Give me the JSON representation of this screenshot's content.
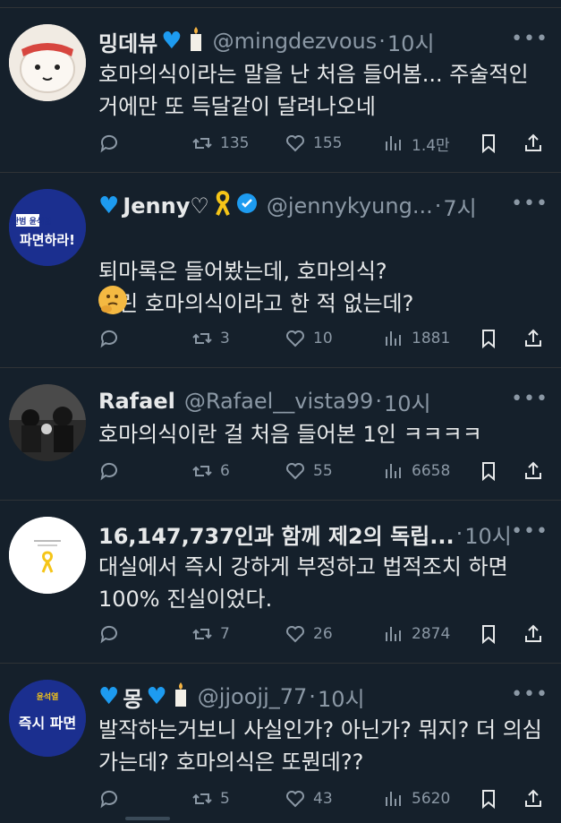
{
  "colors": {
    "background": "#15202b",
    "text": "#e7e9ea",
    "muted": "#8b98a5",
    "accent": "#1d9bf0",
    "divider": "#2f3336"
  },
  "tweets": [
    {
      "name": "밍데뷰",
      "handle": "@mingdezvous",
      "time": "10시",
      "body": "호마의식이라는 말을 난 처음 들어봄... 주술적인 거에만 또 득달같이 달려나오네",
      "replies": "",
      "retweets": "135",
      "likes": "155",
      "views": "1.4만",
      "avatar": "mochi-character-avatar"
    },
    {
      "name": "Jenny♡",
      "handle": "@jennykyung...",
      "time": "7시",
      "body": "퇴마록은 들어봤는데, 호마의식?\n우린 호마의식이라고 한 적 없는데?",
      "replies": "",
      "retweets": "3",
      "likes": "10",
      "views": "1881",
      "avatar_text_top": "내란범 윤석열",
      "avatar_text_bottom": "파면하라!"
    },
    {
      "name": "Rafael",
      "handle": "@Rafael__vista99",
      "time": "10시",
      "body": "호마의식이란 걸 처음 들어본 1인 ㅋㅋㅋㅋ",
      "replies": "",
      "retweets": "6",
      "likes": "55",
      "views": "6658",
      "avatar": "black-and-white-photo-avatar"
    },
    {
      "name": "16,147,737인과 함께 제2의 독립...",
      "handle": "",
      "time": "10시",
      "body": "대실에서 즉시 강하게 부정하고 법적조치 하면 100% 진실이었다.",
      "replies": "",
      "retweets": "7",
      "likes": "26",
      "views": "2874",
      "avatar": "yellow-ribbon-avatar"
    },
    {
      "name": "몽",
      "handle": "@jjoojj_77",
      "time": "10시",
      "body": "발작하는거보니 사실인가? 아닌가? 뭐지? 더 의심가는데? 호마의식은 또뭔데??",
      "replies": "",
      "retweets": "5",
      "likes": "43",
      "views": "5620",
      "avatar_text_top": "윤석열",
      "avatar_text_bottom": "즉시 파면"
    }
  ]
}
